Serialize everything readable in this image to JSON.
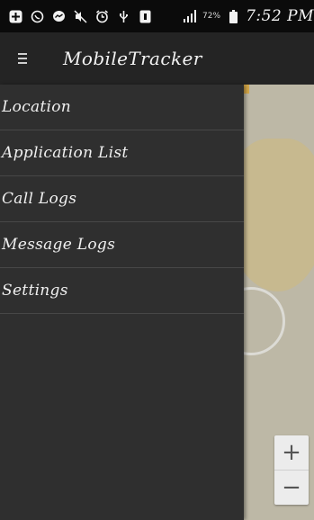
{
  "status_bar": {
    "icons": [
      "plus-square-icon",
      "whatsapp-icon",
      "messenger-icon",
      "mute-icon",
      "alarm-icon",
      "usb-icon",
      "sim-icon"
    ],
    "battery_percent": "72%",
    "time": "7:52 PM"
  },
  "toolbar": {
    "menu_icon": "hamburger-menu-icon",
    "title": "MobileTracker"
  },
  "drawer": {
    "items": [
      {
        "label": "Location"
      },
      {
        "label": "Application List"
      },
      {
        "label": "Call Logs"
      },
      {
        "label": "Message Logs"
      },
      {
        "label": "Settings"
      }
    ]
  },
  "map": {
    "zoom_in_label": "+",
    "zoom_out_label": "−"
  },
  "colors": {
    "status_bar_bg": "#0b0b0b",
    "toolbar_bg": "#242424",
    "drawer_bg": "#2f2f2f",
    "divider": "#474747",
    "text": "#f0f0f0",
    "map_bg": "#bdb8a6"
  }
}
